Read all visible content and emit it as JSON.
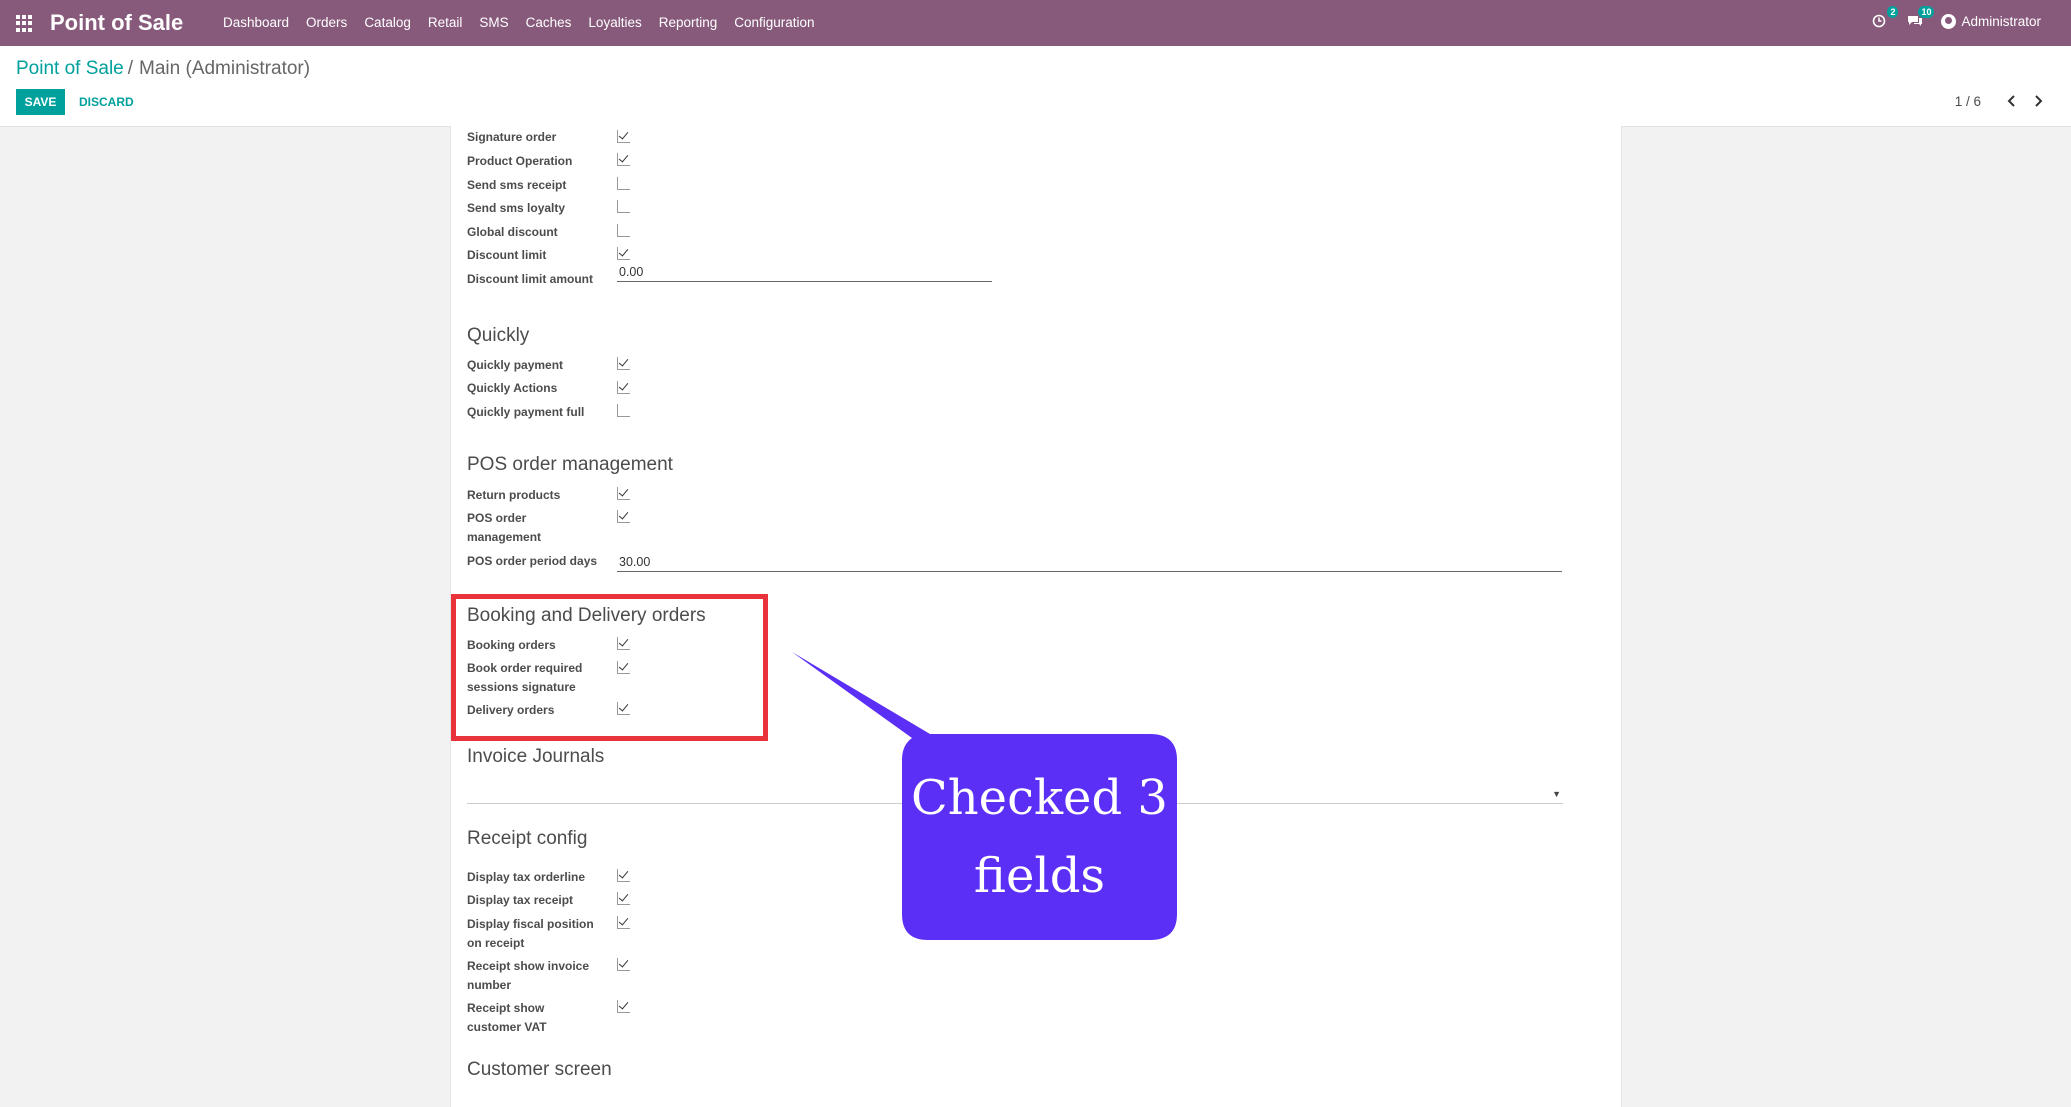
{
  "navbar": {
    "brand": "Point of Sale",
    "menu": [
      "Dashboard",
      "Orders",
      "Catalog",
      "Retail",
      "SMS",
      "Caches",
      "Loyalties",
      "Reporting",
      "Configuration"
    ],
    "activity_badge": "2",
    "messages_badge": "10",
    "user": "Administrator"
  },
  "breadcrumb": {
    "parent": "Point of Sale",
    "separator": "/",
    "current": "Main (Administrator)"
  },
  "actions": {
    "save": "SAVE",
    "discard": "DISCARD"
  },
  "pager": {
    "value": "1 / 6",
    "prev": "‹",
    "next": "›"
  },
  "top_fields": [
    {
      "label": "Signature order",
      "checked": true
    },
    {
      "label": "Product Operation",
      "checked": true
    },
    {
      "label": "Send sms receipt",
      "checked": false
    },
    {
      "label": "Send sms loyalty",
      "checked": false
    },
    {
      "label": "Global discount",
      "checked": false
    },
    {
      "label": "Discount limit",
      "checked": true
    }
  ],
  "discount_limit_amount": {
    "label": "Discount limit amount",
    "value": "0.00"
  },
  "quickly": {
    "title": "Quickly",
    "fields": [
      {
        "label": "Quickly payment",
        "checked": true
      },
      {
        "label": "Quickly Actions",
        "checked": true
      },
      {
        "label": "Quickly payment full",
        "checked": false
      }
    ]
  },
  "pos_order": {
    "title": "POS order management",
    "fields": [
      {
        "label": "Return products",
        "checked": true
      },
      {
        "label": "POS order management",
        "checked": true
      }
    ],
    "period": {
      "label": "POS order period days",
      "value": "30.00"
    }
  },
  "booking": {
    "title": "Booking and Delivery orders",
    "fields": [
      {
        "label": "Booking orders",
        "checked": true
      },
      {
        "label": "Book order required sessions signature",
        "checked": true
      },
      {
        "label": "Delivery orders",
        "checked": true
      }
    ]
  },
  "invoice": {
    "title": "Invoice Journals",
    "value": ""
  },
  "receipt": {
    "title": "Receipt config",
    "fields": [
      {
        "label": "Display tax orderline",
        "checked": true
      },
      {
        "label": "Display tax receipt",
        "checked": true
      },
      {
        "label": "Display fiscal position on receipt",
        "checked": true
      },
      {
        "label": "Receipt show invoice number",
        "checked": true
      },
      {
        "label": "Receipt show customer VAT",
        "checked": true
      }
    ]
  },
  "customer_screen": {
    "title": "Customer screen"
  },
  "annotation": {
    "text": "Checked 3\nfields",
    "callout_color": "#5b2ff5",
    "highlight_color": "#e8333a"
  },
  "colors": {
    "navbar": "#875a7b",
    "accent": "#00a09d"
  }
}
